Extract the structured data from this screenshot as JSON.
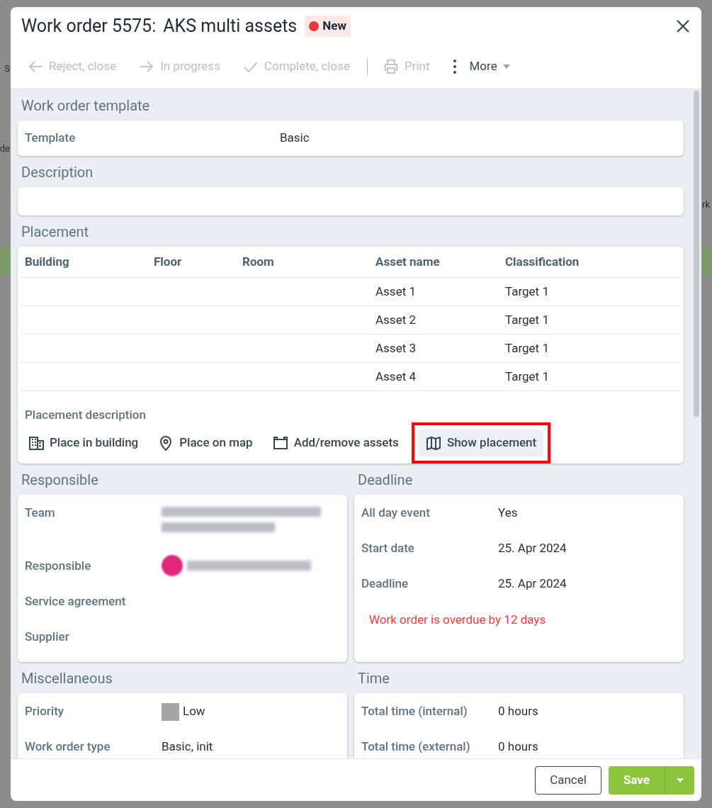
{
  "background": {
    "left_fragments": [
      "S",
      "de"
    ],
    "right_fragments": [
      "rk"
    ]
  },
  "window": {
    "title": "Work order 5575:",
    "subtitle": "AKS multi assets",
    "status": {
      "label": "New",
      "color": "#e53935"
    }
  },
  "toolbar": {
    "actions": [
      {
        "kind": "arrow-left",
        "label": "Reject, close",
        "disabled": true
      },
      {
        "kind": "arrow-right",
        "label": "In progress",
        "disabled": true
      },
      {
        "kind": "check",
        "label": "Complete, close",
        "disabled": true
      }
    ],
    "tools": [
      {
        "kind": "print",
        "label": "Print",
        "disabled": true
      },
      {
        "kind": "more",
        "label": "More",
        "disabled": false
      }
    ]
  },
  "template": {
    "heading": "Work order template",
    "label": "Template",
    "value": "Basic"
  },
  "description": {
    "heading": "Description"
  },
  "placement": {
    "heading": "Placement",
    "columns": [
      "Building",
      "Floor",
      "Room",
      "Asset name",
      "Classification"
    ],
    "rows": [
      [
        "",
        "",
        "",
        "Asset 1",
        "Target 1"
      ],
      [
        "",
        "",
        "",
        "Asset 2",
        "Target 1"
      ],
      [
        "",
        "",
        "",
        "Asset 3",
        "Target 1"
      ],
      [
        "",
        "",
        "",
        "Asset 4",
        "Target 1"
      ]
    ],
    "description_label": "Placement description",
    "actions": [
      {
        "kind": "building",
        "label": "Place in building",
        "highlighted": false
      },
      {
        "kind": "pin",
        "label": "Place on map",
        "highlighted": false
      },
      {
        "kind": "assets",
        "label": "Add/remove assets",
        "highlighted": false
      },
      {
        "kind": "map",
        "label": "Show placement",
        "highlighted": true
      }
    ]
  },
  "responsible": {
    "heading": "Responsible",
    "fields": [
      {
        "kind": "blurred",
        "label": "Team"
      },
      {
        "kind": "blurred-person",
        "label": "Responsible"
      },
      {
        "kind": "empty",
        "label": "Service agreement"
      },
      {
        "kind": "empty",
        "label": "Supplier"
      }
    ]
  },
  "deadline": {
    "heading": "Deadline",
    "fields": [
      {
        "label": "All day event",
        "value": "Yes"
      },
      {
        "label": "Start date",
        "value": "25. Apr 2024"
      },
      {
        "label": "Deadline",
        "value": "25. Apr 2024"
      }
    ],
    "warning": "Work order is overdue by 12 days"
  },
  "miscellaneous": {
    "heading": "Miscellaneous",
    "fields": [
      {
        "label": "Priority",
        "value": "Low",
        "color": "#a6a6a6"
      },
      {
        "label": "Work order type",
        "value": "Basic, init"
      }
    ]
  },
  "time": {
    "heading": "Time",
    "fields": [
      {
        "label": "Total time (internal)",
        "value": "0 hours"
      },
      {
        "label": "Total time (external)",
        "value": "0 hours"
      }
    ]
  },
  "footer": {
    "cancel": "Cancel",
    "save": "Save"
  }
}
